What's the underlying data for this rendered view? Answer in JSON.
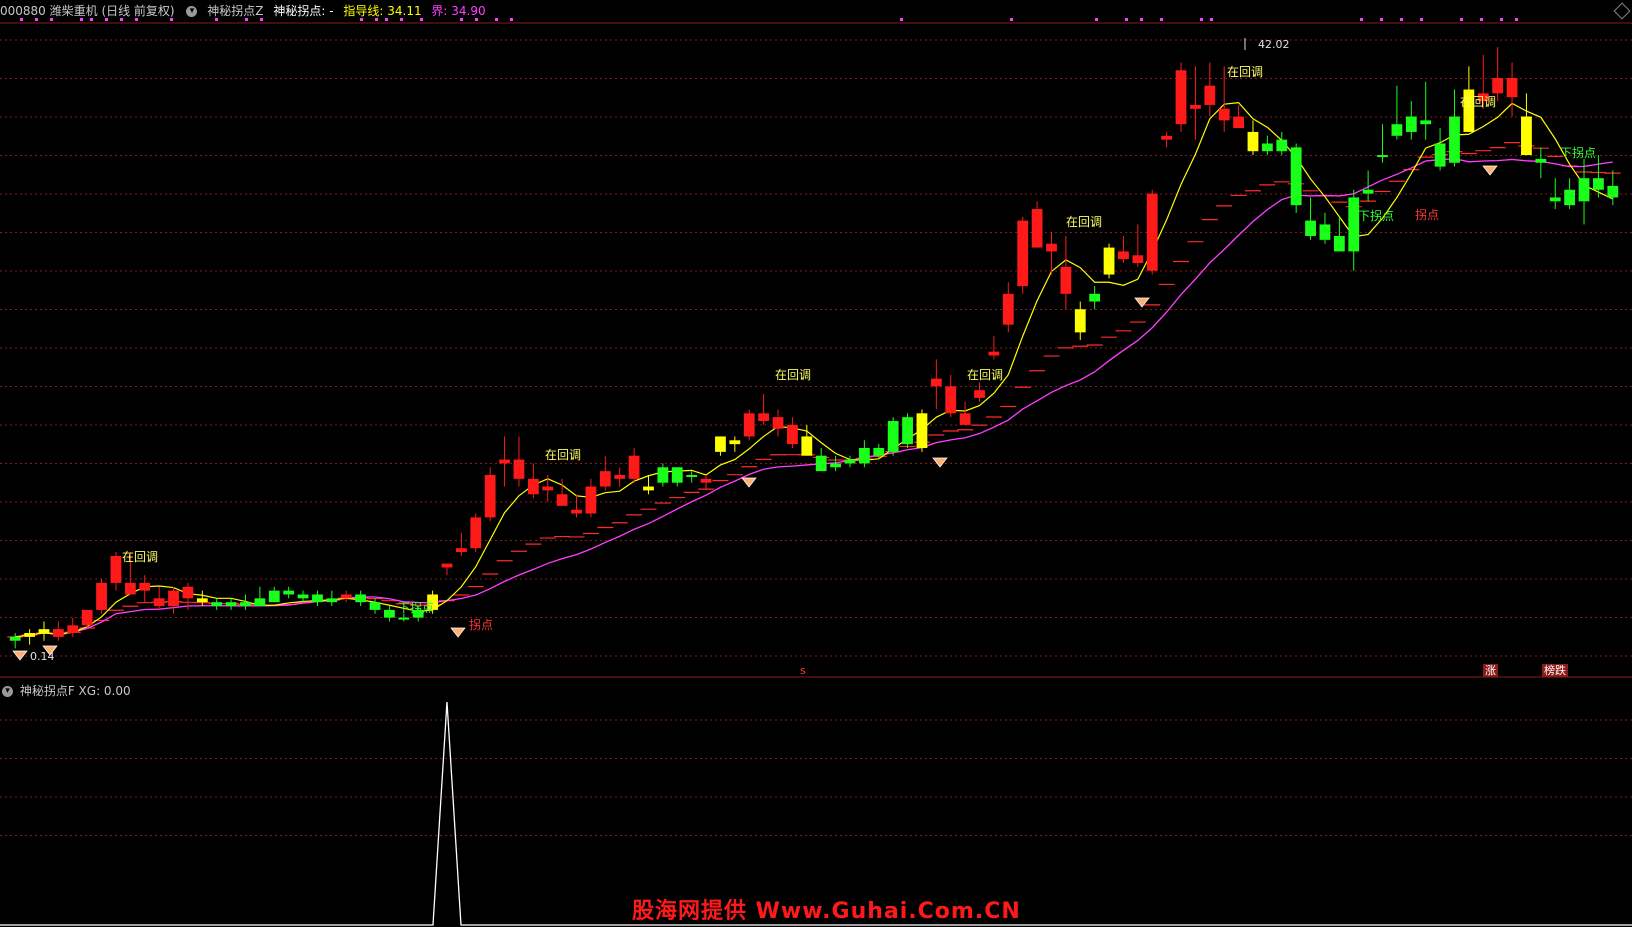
{
  "header": {
    "stock": "000880 潍柴重机 (日线 前复权)",
    "indicator_name": "神秘拐点Z",
    "signal_label": "神秘拐点: -",
    "guide_line": "指导线: 34.11",
    "bound_line": "界: 34.90",
    "guide_color": "#ffff00",
    "bound_color": "#ff40ff"
  },
  "subpanel": {
    "header": "神秘拐点F  XG: 0.00"
  },
  "labels": {
    "callback": "在回调",
    "down_turn": "下拐点",
    "turn": "拐点",
    "price_high": "42.02",
    "price_low": "0.14",
    "tag_rise": "涨",
    "tag_fall": "榜跌",
    "tag_s": "s"
  },
  "watermark": "股海网提供 Www.Guhai.Com.CN",
  "colors": {
    "up": "#ff1a1a",
    "down": "#1aff1a",
    "yellow": "#ffff00",
    "ma_yellow": "#ffff00",
    "ma_magenta": "#ff40ff",
    "grid": "#8b1a1a",
    "xg_line": "#ffffff"
  },
  "chart_data": {
    "type": "candlestick",
    "ylim": [
      26.5,
      43
    ],
    "candles": [
      {
        "o": 27.0,
        "h": 27.2,
        "l": 26.8,
        "c": 27.1,
        "k": "g"
      },
      {
        "o": 27.1,
        "h": 27.3,
        "l": 26.9,
        "c": 27.2,
        "k": "y"
      },
      {
        "o": 27.2,
        "h": 27.5,
        "l": 27.0,
        "c": 27.3,
        "k": "y"
      },
      {
        "o": 27.3,
        "h": 27.5,
        "l": 27.0,
        "c": 27.1,
        "k": "r"
      },
      {
        "o": 27.2,
        "h": 27.6,
        "l": 27.1,
        "c": 27.4,
        "k": "r"
      },
      {
        "o": 27.4,
        "h": 27.8,
        "l": 27.3,
        "c": 27.8,
        "k": "r"
      },
      {
        "o": 27.8,
        "h": 28.6,
        "l": 27.7,
        "c": 28.5,
        "k": "r"
      },
      {
        "o": 28.5,
        "h": 29.3,
        "l": 28.3,
        "c": 29.2,
        "k": "r"
      },
      {
        "o": 28.5,
        "h": 29.3,
        "l": 28.2,
        "c": 28.2,
        "k": "r"
      },
      {
        "o": 28.5,
        "h": 28.7,
        "l": 28.0,
        "c": 28.3,
        "k": "r"
      },
      {
        "o": 28.1,
        "h": 28.4,
        "l": 27.8,
        "c": 27.9,
        "k": "r"
      },
      {
        "o": 27.9,
        "h": 28.4,
        "l": 27.7,
        "c": 28.3,
        "k": "r"
      },
      {
        "o": 28.1,
        "h": 28.5,
        "l": 27.8,
        "c": 28.4,
        "k": "r"
      },
      {
        "o": 28.1,
        "h": 28.3,
        "l": 27.9,
        "c": 28.0,
        "k": "y"
      },
      {
        "o": 28.0,
        "h": 28.1,
        "l": 27.8,
        "c": 27.9,
        "k": "g"
      },
      {
        "o": 28.0,
        "h": 28.1,
        "l": 27.8,
        "c": 27.9,
        "k": "g"
      },
      {
        "o": 28.0,
        "h": 28.2,
        "l": 27.8,
        "c": 27.9,
        "k": "g"
      },
      {
        "o": 28.1,
        "h": 28.4,
        "l": 27.9,
        "c": 27.9,
        "k": "g"
      },
      {
        "o": 28.3,
        "h": 28.4,
        "l": 28.0,
        "c": 28.0,
        "k": "g"
      },
      {
        "o": 28.3,
        "h": 28.4,
        "l": 28.1,
        "c": 28.2,
        "k": "g"
      },
      {
        "o": 28.2,
        "h": 28.3,
        "l": 28.0,
        "c": 28.1,
        "k": "g"
      },
      {
        "o": 28.2,
        "h": 28.3,
        "l": 27.9,
        "c": 28.0,
        "k": "g"
      },
      {
        "o": 28.1,
        "h": 28.3,
        "l": 27.9,
        "c": 28.0,
        "k": "g"
      },
      {
        "o": 28.1,
        "h": 28.3,
        "l": 28.0,
        "c": 28.2,
        "k": "r"
      },
      {
        "o": 28.2,
        "h": 28.3,
        "l": 27.9,
        "c": 28.0,
        "k": "g"
      },
      {
        "o": 28.0,
        "h": 28.1,
        "l": 27.7,
        "c": 27.8,
        "k": "g"
      },
      {
        "o": 27.8,
        "h": 27.9,
        "l": 27.5,
        "c": 27.6,
        "k": "g"
      },
      {
        "o": 27.6,
        "h": 27.7,
        "l": 27.5,
        "c": 27.6,
        "k": "g"
      },
      {
        "o": 27.6,
        "h": 27.9,
        "l": 27.5,
        "c": 27.8,
        "k": "g"
      },
      {
        "o": 27.8,
        "h": 28.3,
        "l": 27.7,
        "c": 28.2,
        "k": "y"
      },
      {
        "o": 28.9,
        "h": 29.0,
        "l": 28.7,
        "c": 29.0,
        "k": "r"
      },
      {
        "o": 29.3,
        "h": 29.8,
        "l": 29.2,
        "c": 29.4,
        "k": "r"
      },
      {
        "o": 29.4,
        "h": 30.3,
        "l": 29.3,
        "c": 30.2,
        "k": "r"
      },
      {
        "o": 30.2,
        "h": 31.5,
        "l": 30.1,
        "c": 31.3,
        "k": "r"
      },
      {
        "o": 31.6,
        "h": 32.3,
        "l": 31.0,
        "c": 31.7,
        "k": "r"
      },
      {
        "o": 31.7,
        "h": 32.3,
        "l": 31.0,
        "c": 31.2,
        "k": "r"
      },
      {
        "o": 31.2,
        "h": 31.6,
        "l": 30.7,
        "c": 30.8,
        "k": "r"
      },
      {
        "o": 30.9,
        "h": 31.3,
        "l": 30.6,
        "c": 31.0,
        "k": "r"
      },
      {
        "o": 30.8,
        "h": 31.2,
        "l": 30.5,
        "c": 30.5,
        "k": "r"
      },
      {
        "o": 30.4,
        "h": 30.8,
        "l": 30.2,
        "c": 30.3,
        "k": "r"
      },
      {
        "o": 30.3,
        "h": 31.2,
        "l": 30.2,
        "c": 31.0,
        "k": "r"
      },
      {
        "o": 31.0,
        "h": 31.8,
        "l": 30.9,
        "c": 31.4,
        "k": "r"
      },
      {
        "o": 31.3,
        "h": 31.5,
        "l": 31.0,
        "c": 31.2,
        "k": "r"
      },
      {
        "o": 31.2,
        "h": 32.0,
        "l": 31.1,
        "c": 31.8,
        "k": "r"
      },
      {
        "o": 30.9,
        "h": 31.3,
        "l": 30.8,
        "c": 31.0,
        "k": "y"
      },
      {
        "o": 31.1,
        "h": 31.6,
        "l": 31.0,
        "c": 31.5,
        "k": "g"
      },
      {
        "o": 31.1,
        "h": 31.5,
        "l": 31.0,
        "c": 31.5,
        "k": "g"
      },
      {
        "o": 31.3,
        "h": 31.4,
        "l": 31.1,
        "c": 31.3,
        "k": "g"
      },
      {
        "o": 31.1,
        "h": 31.3,
        "l": 30.9,
        "c": 31.2,
        "k": "r"
      },
      {
        "o": 31.9,
        "h": 32.3,
        "l": 31.8,
        "c": 32.3,
        "k": "y"
      },
      {
        "o": 32.1,
        "h": 32.3,
        "l": 31.9,
        "c": 32.2,
        "k": "y"
      },
      {
        "o": 32.3,
        "h": 33.0,
        "l": 32.2,
        "c": 32.9,
        "k": "r"
      },
      {
        "o": 32.7,
        "h": 33.4,
        "l": 32.6,
        "c": 32.9,
        "k": "r"
      },
      {
        "o": 32.8,
        "h": 33.0,
        "l": 32.3,
        "c": 32.5,
        "k": "r"
      },
      {
        "o": 32.6,
        "h": 32.8,
        "l": 32.0,
        "c": 32.1,
        "k": "r"
      },
      {
        "o": 32.3,
        "h": 32.6,
        "l": 31.8,
        "c": 31.8,
        "k": "y"
      },
      {
        "o": 31.8,
        "h": 32.0,
        "l": 31.4,
        "c": 31.4,
        "k": "g"
      },
      {
        "o": 31.6,
        "h": 31.8,
        "l": 31.4,
        "c": 31.5,
        "k": "g"
      },
      {
        "o": 31.6,
        "h": 31.8,
        "l": 31.5,
        "c": 31.7,
        "k": "g"
      },
      {
        "o": 31.6,
        "h": 32.2,
        "l": 31.5,
        "c": 32.0,
        "k": "g"
      },
      {
        "o": 31.8,
        "h": 32.1,
        "l": 31.7,
        "c": 32.0,
        "k": "g"
      },
      {
        "o": 31.9,
        "h": 32.8,
        "l": 31.8,
        "c": 32.7,
        "k": "g"
      },
      {
        "o": 32.1,
        "h": 32.9,
        "l": 32.0,
        "c": 32.8,
        "k": "g"
      },
      {
        "o": 32.0,
        "h": 33.0,
        "l": 31.9,
        "c": 32.9,
        "k": "y"
      },
      {
        "o": 33.8,
        "h": 34.3,
        "l": 33.0,
        "c": 33.6,
        "k": "r"
      },
      {
        "o": 33.6,
        "h": 33.9,
        "l": 32.8,
        "c": 32.9,
        "k": "r"
      },
      {
        "o": 32.9,
        "h": 33.2,
        "l": 32.6,
        "c": 32.6,
        "k": "r"
      },
      {
        "o": 33.3,
        "h": 33.7,
        "l": 33.2,
        "c": 33.5,
        "k": "r"
      },
      {
        "o": 34.4,
        "h": 34.9,
        "l": 34.3,
        "c": 34.5,
        "k": "r"
      },
      {
        "o": 35.2,
        "h": 36.3,
        "l": 35.0,
        "c": 36.0,
        "k": "r"
      },
      {
        "o": 36.2,
        "h": 38.0,
        "l": 36.0,
        "c": 37.9,
        "k": "r"
      },
      {
        "o": 38.2,
        "h": 38.4,
        "l": 37.2,
        "c": 37.2,
        "k": "r"
      },
      {
        "o": 37.1,
        "h": 37.6,
        "l": 36.5,
        "c": 37.3,
        "k": "r"
      },
      {
        "o": 36.7,
        "h": 37.5,
        "l": 35.6,
        "c": 36.0,
        "k": "r"
      },
      {
        "o": 35.6,
        "h": 35.8,
        "l": 34.8,
        "c": 35.0,
        "k": "y"
      },
      {
        "o": 35.8,
        "h": 36.2,
        "l": 35.6,
        "c": 36.0,
        "k": "g"
      },
      {
        "o": 36.5,
        "h": 37.3,
        "l": 36.4,
        "c": 37.2,
        "k": "y"
      },
      {
        "o": 37.1,
        "h": 37.5,
        "l": 36.8,
        "c": 36.9,
        "k": "r"
      },
      {
        "o": 37.0,
        "h": 37.8,
        "l": 36.7,
        "c": 36.8,
        "k": "r"
      },
      {
        "o": 36.6,
        "h": 38.7,
        "l": 36.5,
        "c": 38.6,
        "k": "r"
      },
      {
        "o": 40.0,
        "h": 40.2,
        "l": 39.8,
        "c": 40.1,
        "k": "r"
      },
      {
        "o": 40.4,
        "h": 42.0,
        "l": 40.2,
        "c": 41.8,
        "k": "r"
      },
      {
        "o": 40.9,
        "h": 41.9,
        "l": 40.0,
        "c": 40.8,
        "k": "r"
      },
      {
        "o": 40.9,
        "h": 42.0,
        "l": 40.6,
        "c": 41.4,
        "k": "r"
      },
      {
        "o": 40.8,
        "h": 41.9,
        "l": 40.2,
        "c": 40.5,
        "k": "r"
      },
      {
        "o": 40.6,
        "h": 40.9,
        "l": 40.3,
        "c": 40.3,
        "k": "r"
      },
      {
        "o": 40.2,
        "h": 40.5,
        "l": 39.6,
        "c": 39.7,
        "k": "y"
      },
      {
        "o": 39.9,
        "h": 40.1,
        "l": 39.6,
        "c": 39.7,
        "k": "g"
      },
      {
        "o": 40.0,
        "h": 40.2,
        "l": 39.6,
        "c": 39.7,
        "k": "g"
      },
      {
        "o": 39.8,
        "h": 39.9,
        "l": 38.1,
        "c": 38.3,
        "k": "g"
      },
      {
        "o": 37.9,
        "h": 38.5,
        "l": 37.4,
        "c": 37.5,
        "k": "g"
      },
      {
        "o": 37.8,
        "h": 38.1,
        "l": 37.3,
        "c": 37.4,
        "k": "g"
      },
      {
        "o": 37.5,
        "h": 38.0,
        "l": 37.1,
        "c": 37.1,
        "k": "g"
      },
      {
        "o": 38.5,
        "h": 38.7,
        "l": 36.6,
        "c": 37.1,
        "k": "g"
      },
      {
        "o": 38.7,
        "h": 39.2,
        "l": 38.4,
        "c": 38.6,
        "k": "g"
      },
      {
        "o": 39.6,
        "h": 40.4,
        "l": 39.4,
        "c": 39.6,
        "k": "g"
      },
      {
        "o": 40.4,
        "h": 41.4,
        "l": 40.0,
        "c": 40.1,
        "k": "g"
      },
      {
        "o": 40.6,
        "h": 41.0,
        "l": 40.0,
        "c": 40.2,
        "k": "g"
      },
      {
        "o": 40.5,
        "h": 41.5,
        "l": 40.0,
        "c": 40.4,
        "k": "g"
      },
      {
        "o": 39.9,
        "h": 40.3,
        "l": 39.2,
        "c": 39.3,
        "k": "g"
      },
      {
        "o": 39.4,
        "h": 41.3,
        "l": 39.3,
        "c": 40.6,
        "k": "g"
      },
      {
        "o": 41.3,
        "h": 41.9,
        "l": 40.2,
        "c": 40.2,
        "k": "y"
      },
      {
        "o": 41.0,
        "h": 42.2,
        "l": 40.8,
        "c": 41.2,
        "k": "r"
      },
      {
        "o": 41.2,
        "h": 42.4,
        "l": 41.0,
        "c": 41.6,
        "k": "r"
      },
      {
        "o": 41.6,
        "h": 42.0,
        "l": 40.6,
        "c": 41.1,
        "k": "r"
      },
      {
        "o": 40.6,
        "h": 41.2,
        "l": 40.3,
        "c": 39.6,
        "k": "y"
      },
      {
        "o": 39.5,
        "h": 39.8,
        "l": 39.0,
        "c": 39.4,
        "k": "g"
      },
      {
        "o": 38.5,
        "h": 39.0,
        "l": 38.2,
        "c": 38.4,
        "k": "g"
      },
      {
        "o": 38.7,
        "h": 39.0,
        "l": 38.2,
        "c": 38.3,
        "k": "g"
      },
      {
        "o": 39.0,
        "h": 39.5,
        "l": 37.8,
        "c": 38.4,
        "k": "g"
      },
      {
        "o": 39.0,
        "h": 39.6,
        "l": 38.5,
        "c": 38.7,
        "k": "g"
      },
      {
        "o": 38.8,
        "h": 39.2,
        "l": 38.3,
        "c": 38.5,
        "k": "g"
      }
    ],
    "xg_spike_index": 30
  }
}
